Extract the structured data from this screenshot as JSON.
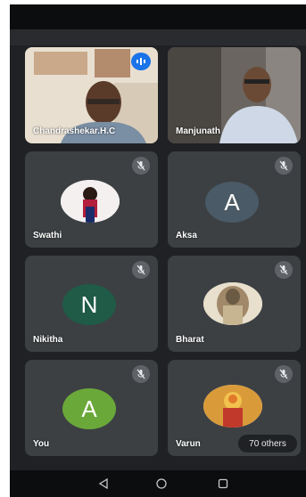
{
  "participants": [
    {
      "name": "Chandrashekar.H.C",
      "speaking": true
    },
    {
      "name": "Manjunath",
      "speaking": false
    },
    {
      "name": "Swathi",
      "muted": true
    },
    {
      "name": "Aksa",
      "muted": true,
      "initial": "A",
      "avatar_color": "#4a5a66"
    },
    {
      "name": "Nikitha",
      "muted": true,
      "initial": "N",
      "avatar_color": "#1f5b46"
    },
    {
      "name": "Bharat",
      "muted": true
    },
    {
      "name": "You",
      "muted": true,
      "initial": "A",
      "avatar_color": "#6ba83a"
    },
    {
      "name": "Varun",
      "muted": true
    }
  ],
  "overflow": {
    "label": "70 others"
  },
  "colors": {
    "background": "#202124",
    "tile": "#3c4043",
    "speaking_indicator": "#1a73e8",
    "mute_badge": "#5f6368"
  },
  "nav": {
    "back_icon": "back-triangle-icon",
    "home_icon": "home-circle-icon",
    "recents_icon": "recents-square-icon"
  }
}
